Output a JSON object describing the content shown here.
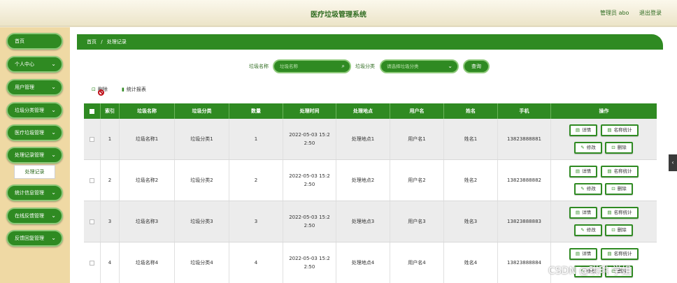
{
  "header": {
    "title": "医疗垃圾管理系统",
    "user": "管理员 abo",
    "logout": "退出登录"
  },
  "sidebar": {
    "items": [
      {
        "label": "首页",
        "chevron": ""
      },
      {
        "label": "个人中心",
        "chevron": "⌄"
      },
      {
        "label": "用户管理",
        "chevron": "⌄"
      },
      {
        "label": "垃圾分类管理",
        "chevron": "⌄"
      },
      {
        "label": "医疗垃圾管理",
        "chevron": "⌄"
      },
      {
        "label": "处理记录管理",
        "chevron": "⌄"
      },
      {
        "label": "统计信息管理",
        "chevron": "⌄"
      },
      {
        "label": "在线反馈管理",
        "chevron": "⌄"
      },
      {
        "label": "反馈回复管理",
        "chevron": "⌄"
      }
    ],
    "sub_item": "处理记录"
  },
  "breadcrumb": {
    "home": "首页",
    "sep": "/",
    "current": "处理记录"
  },
  "search": {
    "name_label": "垃圾名称",
    "name_placeholder": "垃圾名称",
    "category_label": "垃圾分类",
    "category_placeholder": "请选择垃圾分类",
    "query_button": "查询"
  },
  "toolbar": {
    "delete_label": "删除",
    "stats_label": "统计报表"
  },
  "table": {
    "columns": [
      "索引",
      "垃圾名称",
      "垃圾分类",
      "数量",
      "处理时间",
      "处理地点",
      "用户名",
      "姓名",
      "手机",
      "操作"
    ],
    "rows": [
      {
        "index": "1",
        "name": "垃圾名称1",
        "category": "垃圾分类1",
        "qty": "1",
        "time": "2022-05-03 15:22:50",
        "place": "处理地点1",
        "username": "用户名1",
        "realname": "姓名1",
        "phone": "13823888881"
      },
      {
        "index": "2",
        "name": "垃圾名称2",
        "category": "垃圾分类2",
        "qty": "2",
        "time": "2022-05-03 15:22:50",
        "place": "处理地点2",
        "username": "用户名2",
        "realname": "姓名2",
        "phone": "13823888882"
      },
      {
        "index": "3",
        "name": "垃圾名称3",
        "category": "垃圾分类3",
        "qty": "3",
        "time": "2022-05-03 15:22:50",
        "place": "处理地点3",
        "username": "用户名3",
        "realname": "姓名3",
        "phone": "13823888883"
      },
      {
        "index": "4",
        "name": "垃圾名称4",
        "category": "垃圾分类4",
        "qty": "4",
        "time": "2022-05-03 15:22:50",
        "place": "处理地点4",
        "username": "用户名4",
        "realname": "姓名4",
        "phone": "13823888884"
      }
    ],
    "actions": {
      "detail": "详情",
      "name_stats": "名称统计",
      "edit": "修改",
      "delete": "删除"
    }
  },
  "collapse_icon": "‹",
  "watermark": "CSDN @琪琪 学姐",
  "colors": {
    "primary": "#2f8a22",
    "sidebar_bg": "#efd9a4",
    "title": "#2e6b1f"
  }
}
